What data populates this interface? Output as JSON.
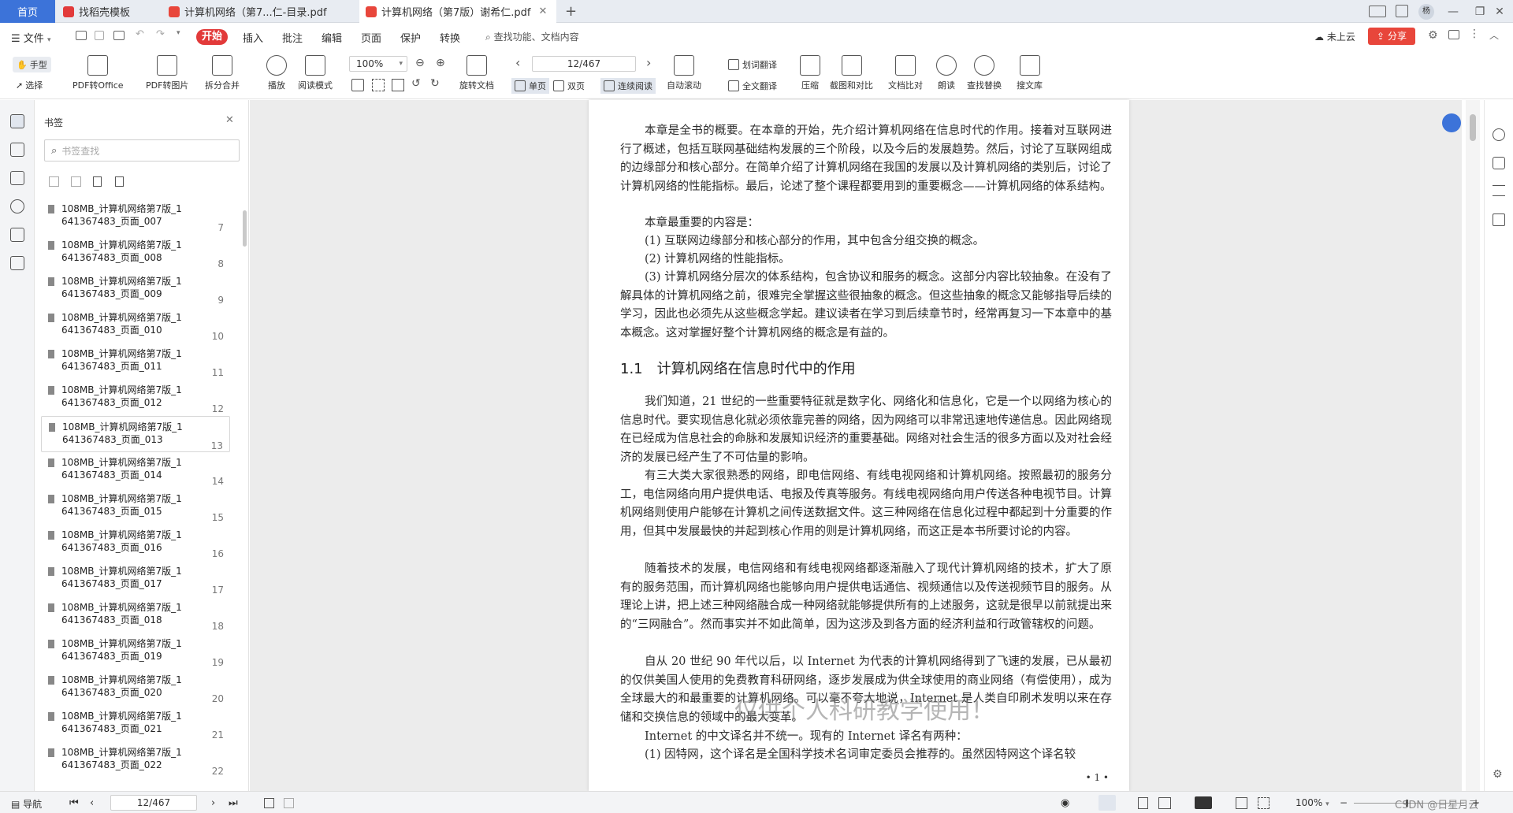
{
  "titlebar": {
    "tabs": [
      {
        "label": "首页"
      },
      {
        "label": "找稻壳模板"
      },
      {
        "label": "计算机网络（第7...仁-目录.pdf"
      },
      {
        "label": "计算机网络（第7版）谢希仁.pdf"
      }
    ],
    "new_tab": "+",
    "user_avatar": "杨",
    "win_controls": [
      "—",
      "❐",
      "✕"
    ]
  },
  "menubar": {
    "file": "文件",
    "items": [
      "开始",
      "插入",
      "批注",
      "编辑",
      "页面",
      "保护",
      "转换"
    ],
    "search_placeholder": "查找功能、文档内容",
    "cloud_status": "未上云",
    "share": "分享"
  },
  "toolbar": {
    "hand": "手型",
    "select": "选择",
    "pdf_to_office": "PDF转Office",
    "pdf_to_image": "PDF转图片",
    "split_merge": "拆分合并",
    "play": "播放",
    "reading_mode": "阅读模式",
    "zoom": "100%",
    "rotate": "旋转文档",
    "page_input": "12/467",
    "single_page": "单页",
    "double_page": "双页",
    "continuous": "连续阅读",
    "auto_scroll": "自动滚动",
    "word_translate": "划词翻译",
    "full_translate": "全文翻译",
    "compress": "压缩",
    "screenshot_compare": "截图和对比",
    "doc_compare": "文档比对",
    "read_aloud": "朗读",
    "find_replace": "查找替换",
    "search_library": "搜文库"
  },
  "bookmarks": {
    "title": "书签",
    "search_placeholder": "书签查找",
    "items": [
      {
        "line1": "108MB_计算机网络第7版_1",
        "line2": "641367483_页面_007",
        "page": "7"
      },
      {
        "line1": "108MB_计算机网络第7版_1",
        "line2": "641367483_页面_008",
        "page": "8"
      },
      {
        "line1": "108MB_计算机网络第7版_1",
        "line2": "641367483_页面_009",
        "page": "9"
      },
      {
        "line1": "108MB_计算机网络第7版_1",
        "line2": "641367483_页面_010",
        "page": "10"
      },
      {
        "line1": "108MB_计算机网络第7版_1",
        "line2": "641367483_页面_011",
        "page": "11"
      },
      {
        "line1": "108MB_计算机网络第7版_1",
        "line2": "641367483_页面_012",
        "page": "12"
      },
      {
        "line1": "108MB_计算机网络第7版_1",
        "line2": "641367483_页面_013",
        "page": "13"
      },
      {
        "line1": "108MB_计算机网络第7版_1",
        "line2": "641367483_页面_014",
        "page": "14"
      },
      {
        "line1": "108MB_计算机网络第7版_1",
        "line2": "641367483_页面_015",
        "page": "15"
      },
      {
        "line1": "108MB_计算机网络第7版_1",
        "line2": "641367483_页面_016",
        "page": "16"
      },
      {
        "line1": "108MB_计算机网络第7版_1",
        "line2": "641367483_页面_017",
        "page": "17"
      },
      {
        "line1": "108MB_计算机网络第7版_1",
        "line2": "641367483_页面_018",
        "page": "18"
      },
      {
        "line1": "108MB_计算机网络第7版_1",
        "line2": "641367483_页面_019",
        "page": "19"
      },
      {
        "line1": "108MB_计算机网络第7版_1",
        "line2": "641367483_页面_020",
        "page": "20"
      },
      {
        "line1": "108MB_计算机网络第7版_1",
        "line2": "641367483_页面_021",
        "page": "21"
      },
      {
        "line1": "108MB_计算机网络第7版_1",
        "line2": "641367483_页面_022",
        "page": "22"
      }
    ],
    "selected_index": 6
  },
  "document": {
    "paragraphs_top": [
      "本章是全书的概要。在本章的开始，先介绍计算机网络在信息时代的作用。接着对互联网进行了概述，包括互联网基础结构发展的三个阶段，以及今后的发展趋势。然后，讨论了互联网组成的边缘部分和核心部分。在简单介绍了计算机网络在我国的发展以及计算机网络的类别后，讨论了计算机网络的性能指标。最后，论述了整个课程都要用到的重要概念——计算机网络的体系结构。",
      "本章最重要的内容是：",
      "(1) 互联网边缘部分和核心部分的作用，其中包含分组交换的概念。",
      "(2) 计算机网络的性能指标。",
      "(3) 计算机网络分层次的体系结构，包含协议和服务的概念。这部分内容比较抽象。在没有了解具体的计算机网络之前，很难完全掌握这些很抽象的概念。但这些抽象的概念又能够指导后续的学习，因此也必须先从这些概念学起。建议读者在学习到后续章节时，经常再复习一下本章中的基本概念。这对掌握好整个计算机网络的概念是有益的。"
    ],
    "heading": "1.1　计算机网络在信息时代中的作用",
    "paragraphs_bottom": [
      "我们知道，21 世纪的一些重要特征就是数字化、网络化和信息化，它是一个以网络为核心的信息时代。要实现信息化就必须依靠完善的网络，因为网络可以非常迅速地传递信息。因此网络现在已经成为信息社会的命脉和发展知识经济的重要基础。网络对社会生活的很多方面以及对社会经济的发展已经产生了不可估量的影响。",
      "有三大类大家很熟悉的网络，即电信网络、有线电视网络和计算机网络。按照最初的服务分工，电信网络向用户提供电话、电报及传真等服务。有线电视网络向用户传送各种电视节目。计算机网络则使用户能够在计算机之间传送数据文件。这三种网络在信息化过程中都起到十分重要的作用，但其中发展最快的并起到核心作用的则是计算机网络，而这正是本书所要讨论的内容。",
      "随着技术的发展，电信网络和有线电视网络都逐渐融入了现代计算机网络的技术，扩大了原有的服务范围，而计算机网络也能够向用户提供电话通信、视频通信以及传送视频节目的服务。从理论上讲，把上述三种网络融合成一种网络就能够提供所有的上述服务，这就是很早以前就提出来的“三网融合”。然而事实并不如此简单，因为这涉及到各方面的经济利益和行政管辖权的问题。",
      "自从 20 世纪 90 年代以后，以 Internet 为代表的计算机网络得到了飞速的发展，已从最初的仅供美国人使用的免费教育科研网络，逐步发展成为供全球使用的商业网络（有偿使用），成为全球最大的和最重要的计算机网络。可以毫不夸大地说，Internet 是人类自印刷术发明以来在存储和交换信息的领域中的最大变革。",
      "Internet 的中文译名并不统一。现有的 Internet 译名有两种：",
      "(1) 因特网，这个译名是全国科学技术名词审定委员会推荐的。虽然因特网这个译名较"
    ],
    "watermark": "仅供个人科研教学使用！",
    "page_number": "• 1 •"
  },
  "statusbar": {
    "nav": "导航",
    "page_input": "12/467",
    "zoom": "100%",
    "zoom_minus": "−",
    "zoom_plus": "+",
    "credit": "CSDN @日星月云"
  },
  "colors": {
    "accent_blue": "#3c73d9",
    "start_red": "#e23a3a",
    "share_red": "#e8463b"
  }
}
